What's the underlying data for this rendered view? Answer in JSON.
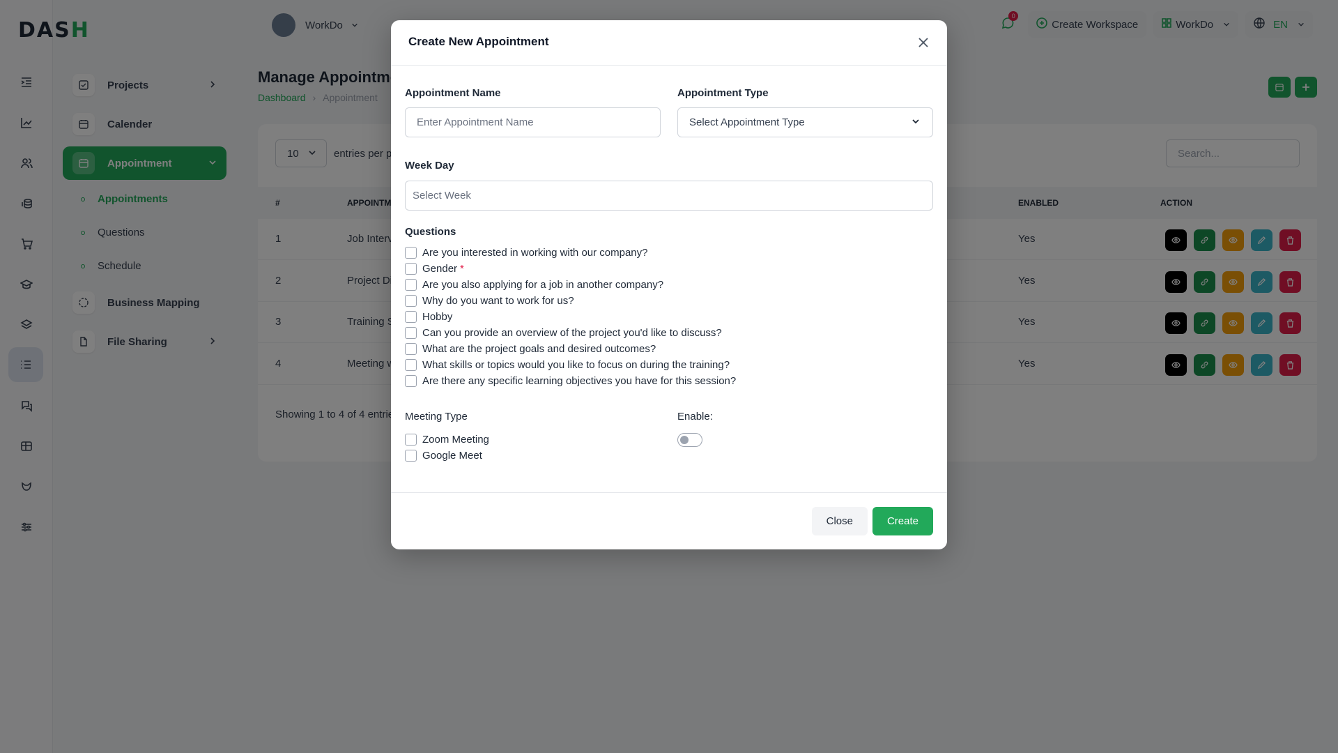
{
  "app": {
    "logo_text": "DASH",
    "workspace_name": "WorkDo",
    "notification_count": "0",
    "create_workspace_label": "Create Workspace",
    "workspace_switch_label": "WorkDo",
    "language": "EN"
  },
  "sidebar": {
    "items": [
      {
        "label": "Projects",
        "icon": "check-square-icon"
      },
      {
        "label": "Calender",
        "icon": "calendar-icon"
      },
      {
        "label": "Appointment",
        "icon": "calendar-clock-icon"
      },
      {
        "label": "Business Mapping",
        "icon": "circle-dashed-icon"
      },
      {
        "label": "File Sharing",
        "icon": "file-icon"
      }
    ],
    "subitems": [
      {
        "label": "Appointments"
      },
      {
        "label": "Questions"
      },
      {
        "label": "Schedule"
      }
    ]
  },
  "page": {
    "title": "Manage Appointmen",
    "breadcrumb": [
      "Dashboard",
      "Appointment"
    ],
    "entries_value": "10",
    "entries_label": "entries per p",
    "search_placeholder": "Search...",
    "columns": [
      "#",
      "APPOINTM",
      "ENABLED",
      "ACTION"
    ],
    "rows": [
      {
        "num": "1",
        "name": "Job Interv",
        "enabled": "Yes"
      },
      {
        "num": "2",
        "name": "Project Di",
        "enabled": "Yes"
      },
      {
        "num": "3",
        "name": "Training S",
        "enabled": "Yes"
      },
      {
        "num": "4",
        "name": "Meeting w",
        "enabled": "Yes"
      }
    ],
    "showing_text": "Showing 1 to 4 of 4 entrie"
  },
  "modal": {
    "title": "Create New Appointment",
    "appointment_name_label": "Appointment Name",
    "appointment_name_placeholder": "Enter Appointment Name",
    "appointment_type_label": "Appointment Type",
    "appointment_type_value": "Select Appointment Type",
    "week_day_label": "Week Day",
    "week_day_placeholder": "Select Week",
    "questions_label": "Questions",
    "questions": [
      {
        "text": "Are you interested in working with our company?",
        "required": ""
      },
      {
        "text": "Gender",
        "required": "*"
      },
      {
        "text": "Are you also applying for a job in another company?",
        "required": ""
      },
      {
        "text": "Why do you want to work for us?",
        "required": ""
      },
      {
        "text": "Hobby",
        "required": ""
      },
      {
        "text": "Can you provide an overview of the project you'd like to discuss?",
        "required": ""
      },
      {
        "text": "What are the project goals and desired outcomes?",
        "required": ""
      },
      {
        "text": "What skills or topics would you like to focus on during the training?",
        "required": ""
      },
      {
        "text": "Are there any specific learning objectives you have for this session?",
        "required": ""
      }
    ],
    "meeting_type_label": "Meeting Type",
    "meeting_types": [
      "Zoom Meeting",
      "Google Meet"
    ],
    "enable_label": "Enable:",
    "enable_state": false,
    "close_label": "Close",
    "create_label": "Create"
  },
  "colors": {
    "accent": "#22a95a",
    "danger": "#e11d48",
    "action_view": "#000000",
    "action_link": "#1b8f4c",
    "action_preview": "#f59e0b",
    "action_edit": "#3ab5c8",
    "action_delete": "#e11d48"
  }
}
